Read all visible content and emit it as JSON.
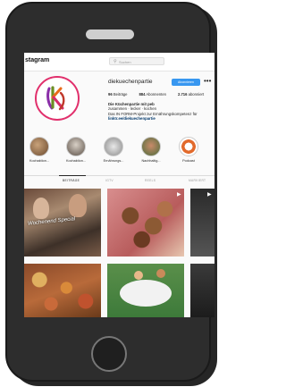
{
  "topbar": {
    "logo_text": "stagram",
    "search_placeholder": "Suchen"
  },
  "profile": {
    "username": "diekuechenpartie",
    "follow_label": "Abonnieren",
    "more_label": "•••",
    "stats": {
      "posts": "96",
      "posts_label": "Beiträge",
      "followers": "884",
      "followers_label": "Abonnenten",
      "following": "2.716",
      "following_label": "abonniert"
    },
    "bio": {
      "name": "Die Küchenpartie mit peb",
      "line1": "zusammen · lecker · kochen",
      "line2": "Das IN FORM-Projekt zur Ernährungskompetenz für",
      "link": "linktr.ee/diekuechenpartie"
    }
  },
  "highlights": [
    {
      "label": "Kochaktion..."
    },
    {
      "label": "Kochaktion..."
    },
    {
      "label": "Ernährungs..."
    },
    {
      "label": "Nachhaltig..."
    },
    {
      "label": "Podcast"
    }
  ],
  "tabs": [
    {
      "label": "BEITRÄGE"
    },
    {
      "label": "IGTV"
    },
    {
      "label": "REELS"
    },
    {
      "label": "MARKIERT"
    }
  ],
  "grid": {
    "tile1_caption": "Wochenend Special"
  },
  "colors": {
    "follow_button": "#3897f0",
    "avatar_ring": "#e1306c",
    "link": "#00376b"
  }
}
